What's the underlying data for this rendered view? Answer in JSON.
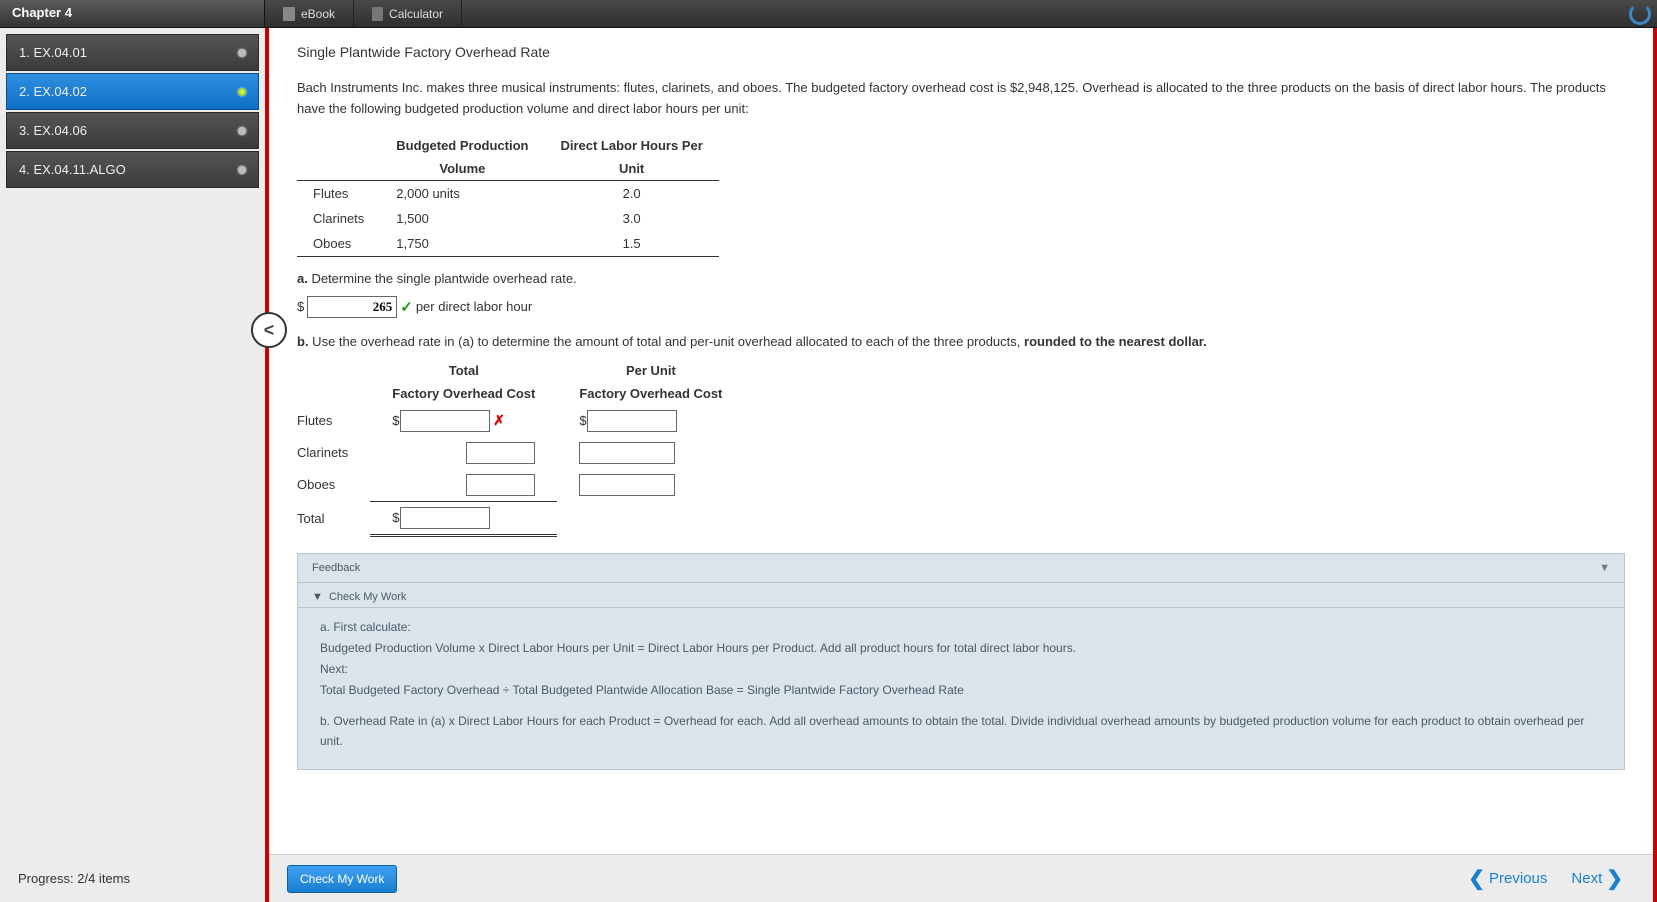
{
  "topbar": {
    "chapter": "Chapter 4",
    "ebook": "eBook",
    "calculator": "Calculator"
  },
  "sidebar": {
    "items": [
      {
        "label": "1. EX.04.01"
      },
      {
        "label": "2. EX.04.02"
      },
      {
        "label": "3. EX.04.06"
      },
      {
        "label": "4. EX.04.11.ALGO"
      }
    ]
  },
  "collapse_glyph": "<",
  "content": {
    "title": "Single Plantwide Factory Overhead Rate",
    "intro": "Bach Instruments Inc. makes three musical instruments: flutes, clarinets, and oboes. The budgeted factory overhead cost is $2,948,125. Overhead is allocated to the three products on the basis of direct labor hours. The products have the following budgeted production volume and direct labor hours per unit:",
    "table1": {
      "h1a": "Budgeted Production",
      "h1b": "Volume",
      "h2a": "Direct Labor Hours Per",
      "h2b": "Unit",
      "rows": [
        {
          "prod": "Flutes",
          "vol": "2,000 units",
          "hrs": "2.0"
        },
        {
          "prod": "Clarinets",
          "vol": "1,500",
          "hrs": "3.0"
        },
        {
          "prod": "Oboes",
          "vol": "1,750",
          "hrs": "1.5"
        }
      ]
    },
    "qa_label": "a.",
    "qa_text": " Determine the single plantwide overhead rate.",
    "qa_answer": "265",
    "qa_after": "per direct labor hour",
    "qb_label": "b.",
    "qb_text_1": " Use the overhead rate in (a) to determine the amount of total and per-unit overhead allocated to each of the three products, ",
    "qb_text_bold": "rounded to the nearest dollar.",
    "table2": {
      "h1a": "Total",
      "h1b": "Factory Overhead Cost",
      "h2a": "Per Unit",
      "h2b": "Factory Overhead Cost",
      "rows": [
        {
          "prod": "Flutes"
        },
        {
          "prod": "Clarinets"
        },
        {
          "prod": "Oboes"
        },
        {
          "prod": "Total"
        }
      ]
    }
  },
  "feedback": {
    "title": "Feedback",
    "subtitle": "Check My Work",
    "l1": "a. First calculate:",
    "l2": "Budgeted Production Volume x Direct Labor Hours per Unit = Direct Labor Hours per Product. Add all product hours for total direct labor hours.",
    "l3": "Next:",
    "l4": "Total Budgeted Factory Overhead ÷ Total Budgeted Plantwide Allocation Base = Single Plantwide Factory Overhead Rate",
    "l5": "b. Overhead Rate in (a) x Direct Labor Hours for each Product = Overhead for each. Add all overhead amounts to obtain the total. Divide individual overhead amounts by budgeted production volume for each product to obtain overhead per unit."
  },
  "footer": {
    "check": "Check My Work",
    "previous": "Previous",
    "next": "Next"
  },
  "progress": "Progress: 2/4 items"
}
